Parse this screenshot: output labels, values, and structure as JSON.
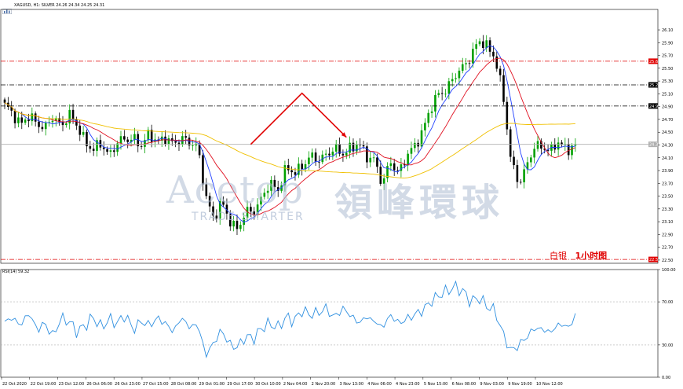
{
  "header": {
    "symbol_line": "XAGUSD, H1: SILVER  24.26 24.34 24.25 24.31",
    "icon": "bar-chart-icon"
  },
  "indicator": {
    "label": "RSI(14) 59.32"
  },
  "watermark": {
    "brand_latin": "Acetop",
    "brand_chinese": "領峰環球",
    "tagline": "TRADE SMARTER"
  },
  "annotation": {
    "part1": "白银",
    "part2": "1小时图"
  },
  "colors": {
    "bull": "#00a000",
    "bear": "#000000",
    "ma_blue": "#2040ff",
    "ma_red": "#e01020",
    "ma_yellow": "#f0c000",
    "rsi": "#3090e0",
    "level_red": "#e00000",
    "level_black": "#000000",
    "arrow": "#e00000"
  },
  "chart_data": [
    {
      "type": "line",
      "subtype": "candlestick",
      "title": "XAGUSD, H1: SILVER",
      "ohlc_header": {
        "open": 24.26,
        "high": 24.34,
        "low": 24.25,
        "close": 24.31
      },
      "ylim": [
        22.45,
        26.42
      ],
      "y_ticks": [
        26.1,
        25.9,
        25.7,
        25.5,
        25.3,
        25.1,
        24.9,
        24.7,
        24.5,
        24.3,
        24.1,
        23.9,
        23.7,
        23.5,
        23.3,
        23.1,
        22.9,
        22.7,
        22.5
      ],
      "y_tick_labels": [
        "26.10",
        "25.90",
        "25.70",
        "25.50",
        "25.30",
        "25.10",
        "24.90",
        "24.70",
        "24.50",
        "24.30",
        "24.10",
        "23.90",
        "23.70",
        "23.50",
        "23.30",
        "23.10",
        "22.90",
        "22.70",
        "22.50"
      ],
      "x_tick_labels": [
        "22 Oct 2020",
        "22 Oct 19:00",
        "23 Oct 12:00",
        "26 Oct 06:00",
        "26 Oct 23:00",
        "27 Oct 15:00",
        "28 Oct 08:00",
        "29 Oct 01:00",
        "29 Oct 17:00",
        "30 Oct 10:00",
        "2 Nov 04:00",
        "2 Nov 20:00",
        "3 Nov 13:00",
        "4 Nov 06:00",
        "4 Nov 23:00",
        "5 Nov 15:00",
        "6 Nov 08:00",
        "9 Nov 03:00",
        "9 Nov 19:00",
        "10 Nov 12:00"
      ],
      "levels": [
        {
          "value": 25.61,
          "label": "25.61",
          "color": "#e00000",
          "style": "dashdot"
        },
        {
          "value": 25.24,
          "label": "25.24",
          "color": "#000000",
          "style": "dashdot"
        },
        {
          "value": 24.91,
          "label": "24.91",
          "color": "#000000",
          "style": "dashdot"
        },
        {
          "value": 24.31,
          "label": "24.31",
          "color": "#b0b0b0",
          "style": "solid"
        },
        {
          "value": 22.51,
          "label": "22.51",
          "color": "#e00000",
          "style": "dashdot"
        }
      ],
      "price_anchors": [
        24.9,
        24.82,
        24.62,
        24.72,
        24.68,
        24.55,
        24.72,
        24.62,
        24.78,
        24.58,
        24.38,
        24.22,
        24.3,
        24.16,
        24.34,
        24.36,
        24.44,
        24.28,
        24.45,
        24.38,
        24.4,
        24.28,
        24.45,
        24.32,
        24.25,
        23.55,
        23.12,
        23.4,
        23.15,
        22.95,
        23.25,
        23.3,
        23.45,
        23.7,
        23.62,
        23.92,
        23.85,
        24.0,
        24.1,
        24.05,
        24.18,
        24.22,
        24.15,
        24.28,
        24.3,
        24.12,
        24.1,
        23.65,
        24.05,
        23.88,
        24.1,
        24.28,
        24.55,
        24.85,
        25.1,
        25.2,
        25.35,
        25.52,
        25.72,
        25.9,
        25.85,
        25.7,
        25.05,
        24.05,
        23.72,
        23.95,
        24.32,
        24.28,
        24.18,
        24.38,
        24.22,
        24.31
      ],
      "series": [
        {
          "name": "MA blue"
        },
        {
          "name": "MA red"
        },
        {
          "name": "MA yellow"
        }
      ],
      "forecast_path": [
        {
          "x_candle": 72,
          "y": 24.31
        },
        {
          "x_candle": 87,
          "y": 25.11
        },
        {
          "x_candle": 100,
          "y": 24.42
        }
      ]
    },
    {
      "type": "line",
      "title": "RSI(14) 59.32",
      "current_value": 59.32,
      "ylim": [
        0,
        100
      ],
      "y_ticks": [
        100,
        70,
        30,
        0
      ],
      "y_tick_labels": [
        "100.00",
        "70.00",
        "30.00",
        "0.00"
      ],
      "levels": [
        70,
        30
      ],
      "values": [
        52,
        55,
        48,
        60,
        44,
        50,
        38,
        55,
        52,
        42,
        48,
        56,
        46,
        54,
        50,
        58,
        44,
        52,
        48,
        55,
        50,
        42,
        56,
        46,
        50,
        20,
        32,
        44,
        30,
        28,
        38,
        36,
        46,
        50,
        46,
        56,
        52,
        62,
        58,
        60,
        64,
        55,
        64,
        58,
        50,
        56,
        52,
        46,
        58,
        50,
        54,
        58,
        62,
        70,
        76,
        80,
        84,
        80,
        70,
        74,
        66,
        62,
        40,
        24,
        30,
        38,
        46,
        44,
        42,
        50,
        46,
        54
      ]
    }
  ]
}
